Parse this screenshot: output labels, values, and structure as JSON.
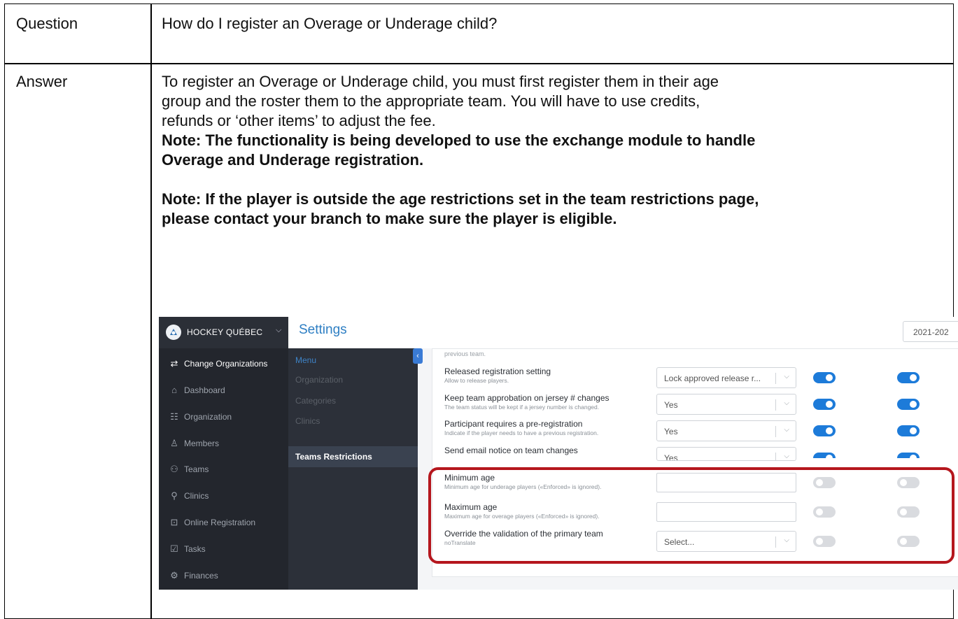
{
  "doc": {
    "question_label": "Question",
    "question_text": "How do I register an Overage or Underage child?",
    "answer_label": "Answer",
    "answer_lines": [
      "To register an Overage or Underage child, you must first register them in their age",
      "group and the roster them to the appropriate team. You will have to use credits,",
      "refunds or ‘other items’ to adjust the fee."
    ],
    "note1_lines": [
      "Note: The functionality is being developed to use the exchange module to handle",
      "Overage and Underage registration."
    ],
    "note2_lines": [
      "Note: If the player is outside the age restrictions set in the team restrictions page,",
      "please contact your branch to make sure the player is eligible."
    ]
  },
  "screenshot": {
    "org_name": "HOCKEY QUÉBEC",
    "page_title": "Settings",
    "season": "2021-202",
    "sidebar": [
      {
        "label": "Change Organizations",
        "icon": "swap-arrows-icon"
      },
      {
        "label": "Dashboard",
        "icon": "home-icon"
      },
      {
        "label": "Organization",
        "icon": "org-chart-icon"
      },
      {
        "label": "Members",
        "icon": "person-icon"
      },
      {
        "label": "Teams",
        "icon": "people-icon"
      },
      {
        "label": "Clinics",
        "icon": "ribbon-icon"
      },
      {
        "label": "Online Registration",
        "icon": "register-icon"
      },
      {
        "label": "Tasks",
        "icon": "tasks-icon"
      },
      {
        "label": "Finances",
        "icon": "finance-icon"
      }
    ],
    "submenu": {
      "header": "Menu",
      "items": [
        "Organization",
        "Categories",
        "Clinics"
      ],
      "active": "Teams Restrictions"
    },
    "previous_team_text": "previous team.",
    "settings": [
      {
        "title": "Released registration setting",
        "desc": "Allow to release players.",
        "value": "Lock approved release r...",
        "control": "select",
        "toggle1": true,
        "toggle2": true
      },
      {
        "title": "Keep team approbation on jersey # changes",
        "desc": "The team status will be kept if a jersey number is changed.",
        "value": "Yes",
        "control": "select",
        "toggle1": true,
        "toggle2": true
      },
      {
        "title": "Participant requires a pre-registration",
        "desc": "Indicate if the player needs to have a previous registration.",
        "value": "Yes",
        "control": "select",
        "toggle1": true,
        "toggle2": true
      },
      {
        "title": "Send email notice on team changes",
        "desc": "",
        "value": "Yes",
        "control": "select",
        "toggle1": true,
        "toggle2": true
      },
      {
        "title": "Minimum age",
        "desc": "Minimum age for underage players («Enforced» is ignored).",
        "value": "",
        "control": "text",
        "toggle1": false,
        "toggle2": false
      },
      {
        "title": "Maximum age",
        "desc": "Maximum age for overage players («Enforced» is ignored).",
        "value": "",
        "control": "text",
        "toggle1": false,
        "toggle2": false
      },
      {
        "title": "Override the validation of the primary team",
        "desc": "noTranslate",
        "value": "Select...",
        "control": "select",
        "toggle1": false,
        "toggle2": false
      }
    ],
    "highlight_color": "#b5161d",
    "accent_color": "#1d7bd9"
  }
}
